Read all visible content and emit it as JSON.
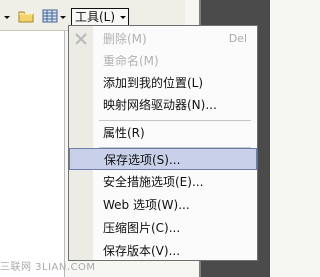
{
  "toolbar": {
    "tools_label": "工具(L)",
    "buttons": {
      "folder_icon": "folder-icon",
      "view_icon": "view-icon"
    }
  },
  "menu": {
    "items": [
      {
        "label": "删除(M)",
        "shortcut": "Del",
        "disabled": true
      },
      {
        "label": "重命名(M)",
        "shortcut": "",
        "disabled": true
      },
      {
        "label": "添加到我的位置(L)",
        "shortcut": "",
        "disabled": false
      },
      {
        "label": "映射网络驱动器(N)...",
        "shortcut": "",
        "disabled": false
      },
      {
        "label": "属性(R)",
        "shortcut": "",
        "disabled": false
      },
      {
        "label": "保存选项(S)...",
        "shortcut": "",
        "disabled": false,
        "selected": true
      },
      {
        "label": "安全措施选项(E)...",
        "shortcut": "",
        "disabled": false
      },
      {
        "label": "Web 选项(W)...",
        "shortcut": "",
        "disabled": false
      },
      {
        "label": "压缩图片(C)...",
        "shortcut": "",
        "disabled": false
      },
      {
        "label": "保存版本(V)...",
        "shortcut": "",
        "disabled": false
      }
    ]
  },
  "watermark": {
    "text": "三联网 3LIAN.COM"
  },
  "colors": {
    "selection": "#c9d1ea",
    "selection_border": "#6b7da8",
    "menu_border": "#6f6f6f"
  }
}
